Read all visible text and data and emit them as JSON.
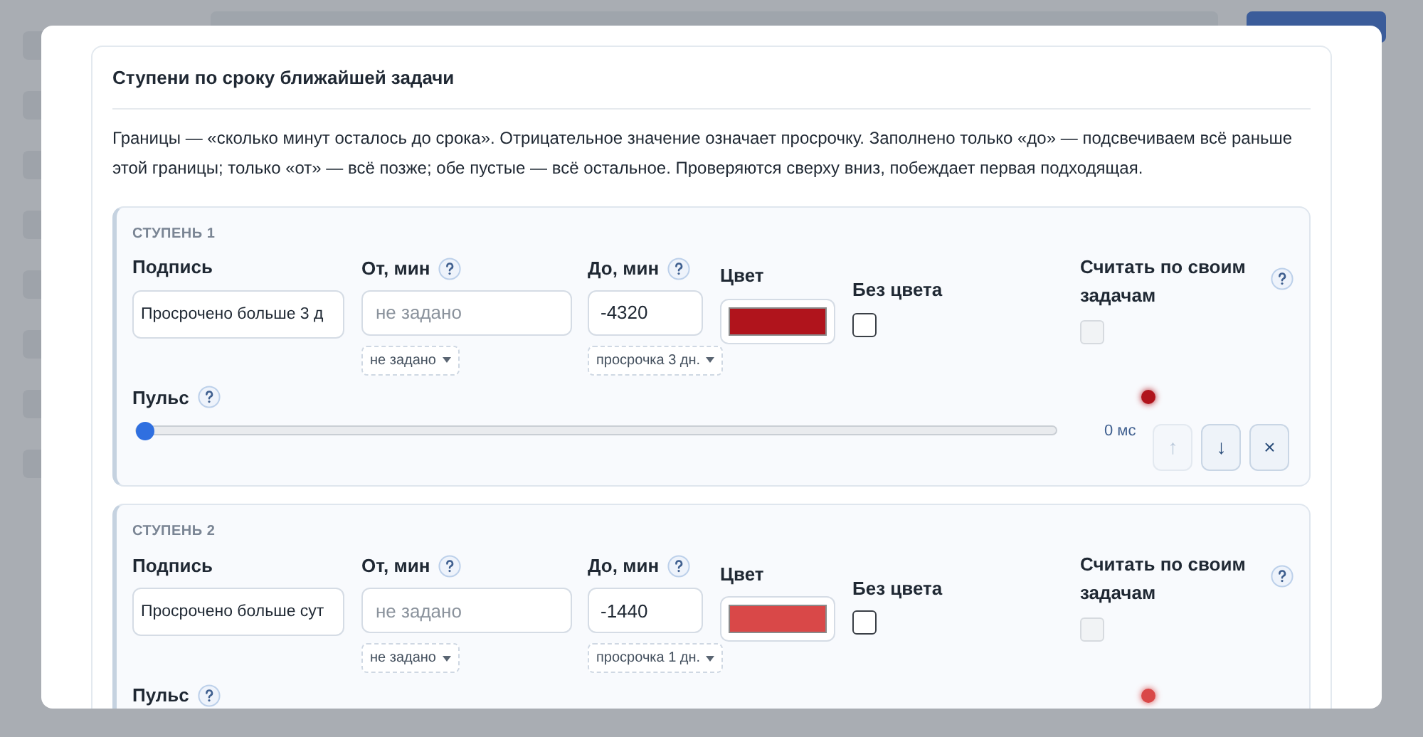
{
  "section": {
    "title": "Ступени по сроку ближайшей задачи",
    "description": "Границы — «сколько минут осталось до срока». Отрицательное значение означает просрочку. Заполнено только «до» — подсвечиваем всё раньше этой границы; только «от» — всё позже; обе пустые — всё остальное. Проверяются сверху вниз, побеждает первая подходящая."
  },
  "stages": [
    {
      "title": "СТУПЕНЬ 1",
      "label_caption": "Подпись",
      "label_value": "Просрочено больше 3 д",
      "from_caption": "От, мин",
      "from_placeholder": "не задано",
      "from_hint": "не задано",
      "to_caption": "До, мин",
      "to_value": "-4320",
      "to_hint": "просрочка 3 дн.",
      "color_caption": "Цвет",
      "color": "#b0141c",
      "no_color_caption": "Без цвета",
      "no_color": false,
      "own_tasks_caption": "Считать по своим задачам",
      "own_tasks": false,
      "own_tasks_disabled": true,
      "pulse_caption": "Пульс",
      "pulse": {
        "level": 0,
        "reading": "0 мс"
      },
      "actions": [
        {
          "label": "↑",
          "disabled": true
        },
        {
          "label": "↓",
          "disabled": false
        },
        {
          "label": "×",
          "disabled": false
        }
      ]
    },
    {
      "title": "СТУПЕНЬ 2",
      "label_caption": "Подпись",
      "label_value": "Просрочено больше сут",
      "from_caption": "От, мин",
      "from_placeholder": "не задано",
      "from_hint": "не задано",
      "to_caption": "До, мин",
      "to_value": "-1440",
      "to_hint": "просрочка 1 дн.",
      "color_caption": "Цвет",
      "color": "#d94848",
      "no_color_caption": "Без цвета",
      "no_color": false,
      "own_tasks_caption": "Считать по своим задачам",
      "own_tasks": false,
      "own_tasks_disabled": true,
      "pulse_caption": "Пульс"
    }
  ]
}
